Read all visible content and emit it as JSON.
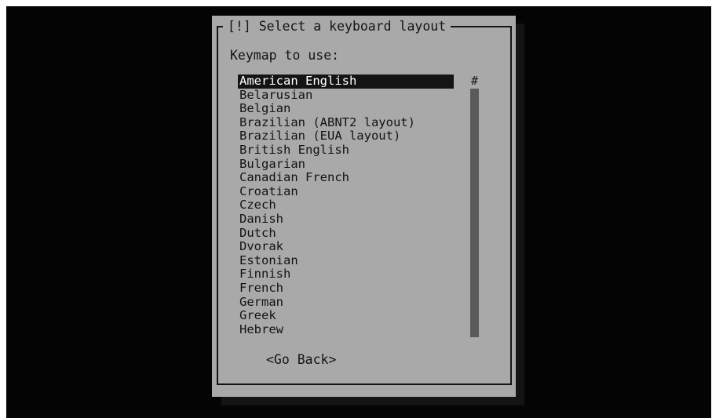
{
  "dialog": {
    "title": "[!] Select a keyboard layout",
    "prompt": "Keymap to use:",
    "scroll_marker": "#",
    "keymaps": [
      "American English",
      "Belarusian",
      "Belgian",
      "Brazilian (ABNT2 layout)",
      "Brazilian (EUA layout)",
      "British English",
      "Bulgarian",
      "Canadian French",
      "Croatian",
      "Czech",
      "Danish",
      "Dutch",
      "Dvorak",
      "Estonian",
      "Finnish",
      "French",
      "German",
      "Greek",
      "Hebrew"
    ],
    "selected_index": 0,
    "go_back_label": "<Go Back>"
  },
  "colors": {
    "screen_background": "#040404",
    "dialog_background": "#a9a9a9",
    "text": "#141414",
    "selection_background": "#141414",
    "selection_text": "#ffffff",
    "scrollbar": "#5a5a5a"
  }
}
